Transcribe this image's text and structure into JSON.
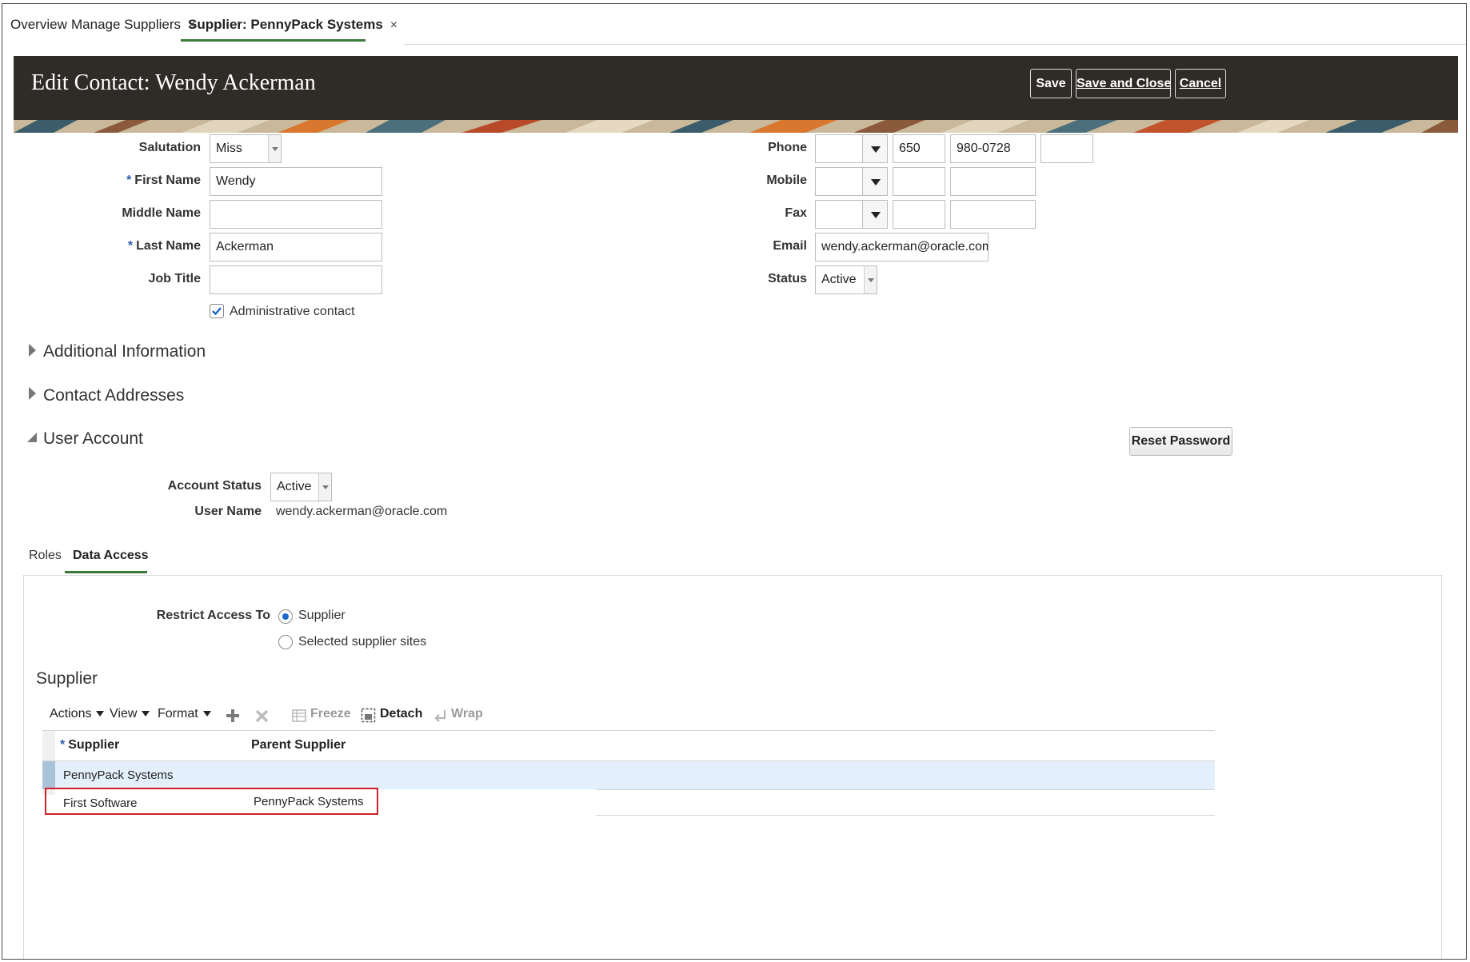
{
  "nav_tabs": {
    "overview": "Overview",
    "manage_suppliers": "Manage Suppliers",
    "supplier": "Supplier: PennyPack Systems",
    "close": "×"
  },
  "header": {
    "title": "Edit Contact: Wendy Ackerman",
    "save": "Save",
    "save_and_close": "Save and Close",
    "cancel": "Cancel"
  },
  "contact": {
    "salutation_label": "Salutation",
    "salutation_value": "Miss",
    "first_name_label": "First Name",
    "first_name_value": "Wendy",
    "middle_name_label": "Middle Name",
    "middle_name_value": "",
    "last_name_label": "Last Name",
    "last_name_value": "Ackerman",
    "job_title_label": "Job Title",
    "job_title_value": "",
    "admin_contact_label": "Administrative contact",
    "admin_contact_checked": true,
    "required_mark": "*"
  },
  "contact_right": {
    "phone_label": "Phone",
    "phone_area": "650",
    "phone_number": "980-0728",
    "mobile_label": "Mobile",
    "fax_label": "Fax",
    "email_label": "Email",
    "email_value": "wendy.ackerman@oracle.com",
    "status_label": "Status",
    "status_value": "Active"
  },
  "sections": {
    "additional_information": "Additional Information",
    "contact_addresses": "Contact Addresses",
    "user_account": "User Account",
    "reset_password": "Reset Password"
  },
  "user_account": {
    "account_status_label": "Account Status",
    "account_status_value": "Active",
    "user_name_label": "User Name",
    "user_name_value": "wendy.ackerman@oracle.com"
  },
  "sub_tabs": {
    "roles": "Roles",
    "data_access": "Data Access"
  },
  "data_access": {
    "restrict_label": "Restrict Access To",
    "option_supplier": "Supplier",
    "option_sites": "Selected supplier sites",
    "selected": "supplier"
  },
  "supplier_table": {
    "title": "Supplier",
    "toolbar": {
      "actions": "Actions",
      "view": "View",
      "format": "Format",
      "freeze": "Freeze",
      "detach": "Detach",
      "wrap": "Wrap"
    },
    "columns": [
      "Supplier",
      "Parent Supplier"
    ],
    "rows": [
      {
        "supplier": "PennyPack Systems",
        "parent": ""
      },
      {
        "supplier": "First Software",
        "parent": "PennyPack Systems"
      }
    ]
  },
  "colors": {
    "header_bg": "#2f2b27",
    "active_tab_underline": "#3c7a3c",
    "required_asterisk": "#2a5db0",
    "selected_row": "#e3f0fb",
    "highlight_box": "#d0202a"
  }
}
